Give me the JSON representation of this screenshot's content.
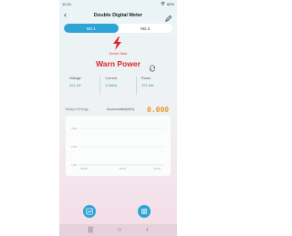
{
  "status_bar": {
    "time": "11:24",
    "battery": "80%"
  },
  "header": {
    "title": "Double Digital Meter",
    "back_glyph": "‹"
  },
  "tabs": [
    {
      "label": "M2.1",
      "active": true
    },
    {
      "label": "M2.2",
      "active": false
    }
  ],
  "device_status": {
    "label": "Device State",
    "state": "Warn Power"
  },
  "stats": [
    {
      "label": "Voltage",
      "value": "221.3V"
    },
    {
      "label": "Current",
      "value": "3.306A"
    },
    {
      "label": "Power",
      "value": "721.4W"
    }
  ],
  "energy": {
    "today_label": "Today's Energy",
    "accum_label": "Accumulate(kWh)",
    "accum_value": "0.000"
  },
  "chart": {
    "y_ticks": [
      "3.00",
      "2.00",
      "1.00"
    ],
    "x_ticks": [
      "00:00",
      "12:00",
      "23:00"
    ]
  },
  "nav_bar": {
    "recents_glyph": "|||",
    "home_glyph": "○",
    "back_glyph": "‹"
  },
  "colors": {
    "accent": "#2ea3d6",
    "warn": "#e0242b",
    "value_green": "#2e9c84",
    "energy_orange": "#e79b2a"
  }
}
